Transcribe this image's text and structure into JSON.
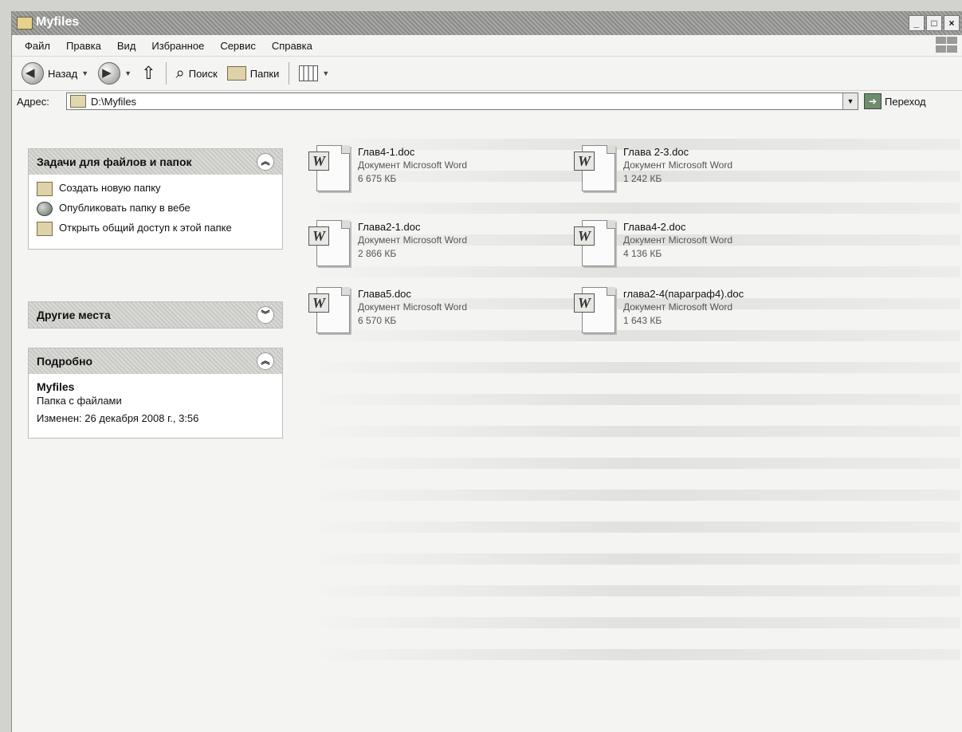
{
  "window": {
    "title": "Myfiles",
    "buttons": {
      "minimize": "_",
      "maximize": "□",
      "close": "×"
    }
  },
  "menu": [
    {
      "label": "Файл"
    },
    {
      "label": "Правка"
    },
    {
      "label": "Вид"
    },
    {
      "label": "Избранное"
    },
    {
      "label": "Сервис"
    },
    {
      "label": "Справка"
    }
  ],
  "toolbar": {
    "back_label": "Назад",
    "search_label": "Поиск",
    "folders_label": "Папки"
  },
  "address": {
    "label": "Адрес:",
    "value": "D:\\Myfiles",
    "go_label": "Переход"
  },
  "tasks_panel": {
    "title": "Задачи для файлов и папок",
    "items": [
      {
        "label": "Создать новую папку",
        "icon": "new-folder-icon"
      },
      {
        "label": "Опубликовать папку в вебе",
        "icon": "globe-icon"
      },
      {
        "label": "Открыть общий доступ к этой папке",
        "icon": "share-folder-icon"
      }
    ]
  },
  "other_places_panel": {
    "title": "Другие места"
  },
  "details_panel": {
    "title": "Подробно",
    "name": "Myfiles",
    "type": "Папка с файлами",
    "modified": "Изменен: 26 декабря 2008 г., 3:56"
  },
  "files": [
    {
      "name": "Глав4-1.doc",
      "type": "Документ Microsoft Word",
      "size": "6 675 КБ"
    },
    {
      "name": "Глава 2-3.doc",
      "type": "Документ Microsoft Word",
      "size": "1 242 КБ"
    },
    {
      "name": "Глава2-1.doc",
      "type": "Документ Microsoft Word",
      "size": "2 866 КБ"
    },
    {
      "name": "Глава4-2.doc",
      "type": "Документ Microsoft Word",
      "size": "4 136 КБ"
    },
    {
      "name": "Глава5.doc",
      "type": "Документ Microsoft Word",
      "size": "6 570 КБ"
    },
    {
      "name": "глава2-4(параграф4).doc",
      "type": "Документ Microsoft Word",
      "size": "1 643 КБ"
    }
  ],
  "colors": {
    "titlebar": "#8a8a88",
    "window_bg": "#f4f4f2",
    "panel_head": "#d0d0cc"
  }
}
